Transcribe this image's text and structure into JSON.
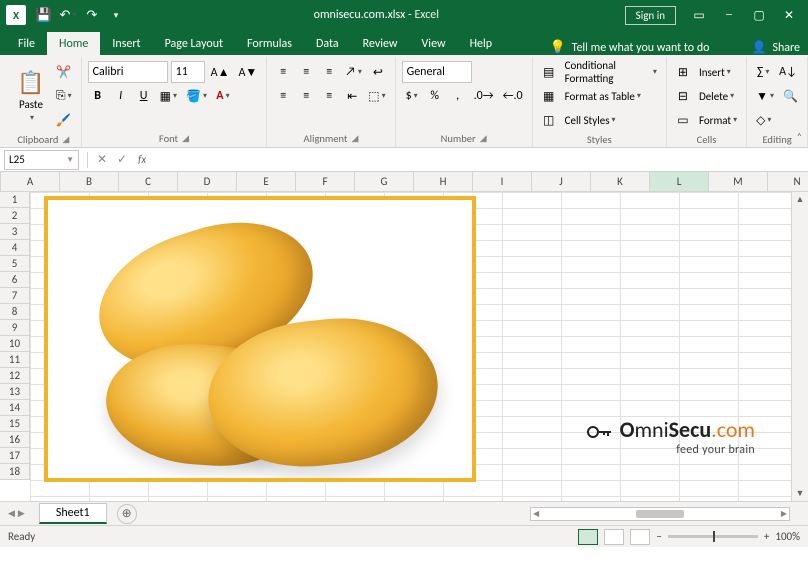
{
  "title": {
    "doc": "omnisecu.com.xlsx",
    "app": "Excel"
  },
  "signin": "Sign in",
  "tabs": {
    "file": "File",
    "home": "Home",
    "insert": "Insert",
    "pagelayout": "Page Layout",
    "formulas": "Formulas",
    "data": "Data",
    "review": "Review",
    "view": "View",
    "help": "Help",
    "tellme": "Tell me what you want to do",
    "share": "Share"
  },
  "ribbon": {
    "clipboard": {
      "paste": "Paste",
      "label": "Clipboard"
    },
    "font": {
      "name": "Calibri",
      "size": "11",
      "label": "Font"
    },
    "alignment": {
      "label": "Alignment"
    },
    "number": {
      "format": "General",
      "label": "Number"
    },
    "styles": {
      "cond": "Conditional Formatting",
      "table": "Format as Table",
      "cell": "Cell Styles",
      "label": "Styles"
    },
    "cells": {
      "insert": "Insert",
      "delete": "Delete",
      "format": "Format",
      "label": "Cells"
    },
    "editing": {
      "label": "Editing"
    }
  },
  "formula_bar": {
    "name": "L25"
  },
  "columns": [
    "A",
    "B",
    "C",
    "D",
    "E",
    "F",
    "G",
    "H",
    "I",
    "J",
    "K",
    "L",
    "M",
    "N"
  ],
  "rows": [
    "1",
    "2",
    "3",
    "4",
    "5",
    "6",
    "7",
    "8",
    "9",
    "10",
    "11",
    "12",
    "13",
    "14",
    "15",
    "16",
    "17",
    "18"
  ],
  "watermark": {
    "pre": "O",
    "brand": "mni",
    "secu": "Secu",
    "dot": ".com",
    "tag": "feed your brain"
  },
  "sheet": {
    "name": "Sheet1"
  },
  "status": {
    "ready": "Ready",
    "zoom": "100%"
  },
  "selected_col": "L"
}
